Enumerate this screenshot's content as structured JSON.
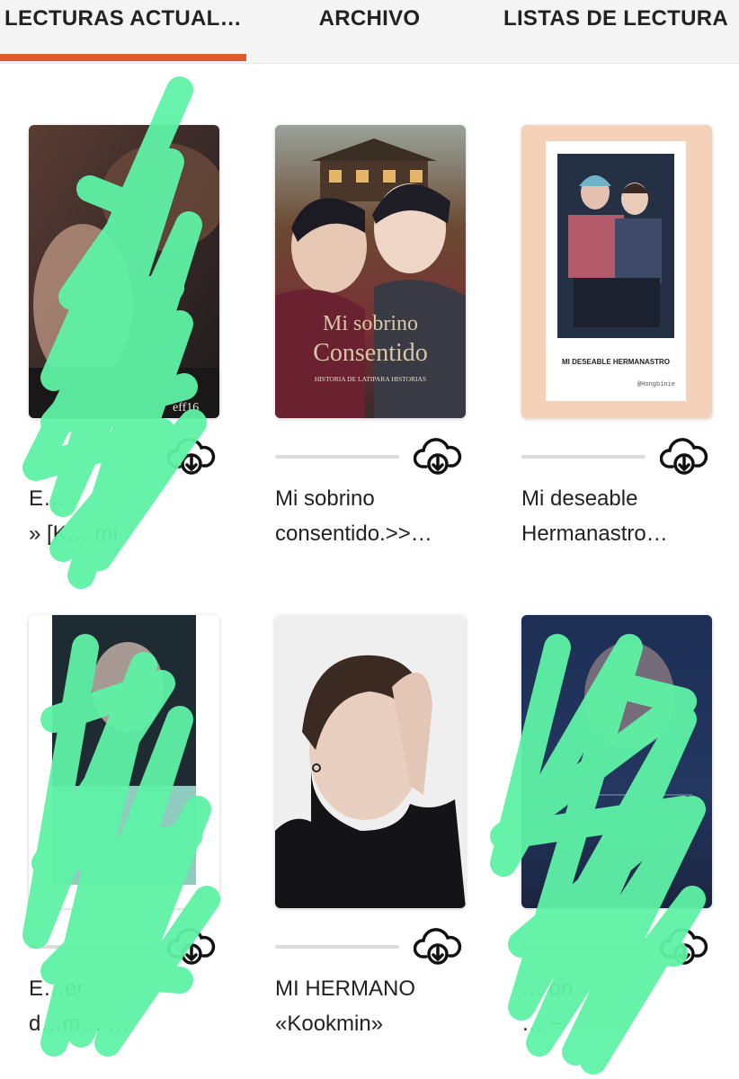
{
  "tabs": [
    {
      "label": "LECTURAS ACTUAL…",
      "active": true
    },
    {
      "label": "ARCHIVO",
      "active": false
    },
    {
      "label": "LISTAS DE LECTURA",
      "active": false
    }
  ],
  "accent_color": "#e05a2b",
  "scribble_color": "#5ff2a6",
  "books": [
    {
      "cover_lines": [
        "",
        "eff16"
      ],
      "title_lines": [
        "E…",
        "» [K… mi"
      ],
      "progress": 0,
      "download_icon": "cloud-download-icon"
    },
    {
      "cover_lines": [
        "Mi sobrino",
        "Consentido",
        "HISTORIA DE LATIPARA HISTORIAS"
      ],
      "title_lines": [
        "Mi sobrino",
        "consentido.>>…"
      ],
      "progress": 0,
      "download_icon": "cloud-download-icon"
    },
    {
      "cover_lines": [
        "MI DESEABLE HERMANASTRO",
        "@Hongbinie"
      ],
      "title_lines": [
        "Mi deseable",
        "Hermanastro…"
      ],
      "progress": 0,
      "download_icon": "cloud-download-icon"
    },
    {
      "cover_lines": [],
      "title_lines": [
        "E…er",
        "d…m… …"
      ],
      "progress": 0,
      "download_icon": "cloud-download-icon"
    },
    {
      "cover_lines": [],
      "title_lines": [
        "MI HERMANO",
        "«Kookmin»"
      ],
      "progress": 0,
      "download_icon": "cloud-download-icon"
    },
    {
      "cover_lines": [],
      "title_lines": [
        "… on",
        "… ~"
      ],
      "progress": 0,
      "download_icon": "cloud-download-icon"
    }
  ]
}
